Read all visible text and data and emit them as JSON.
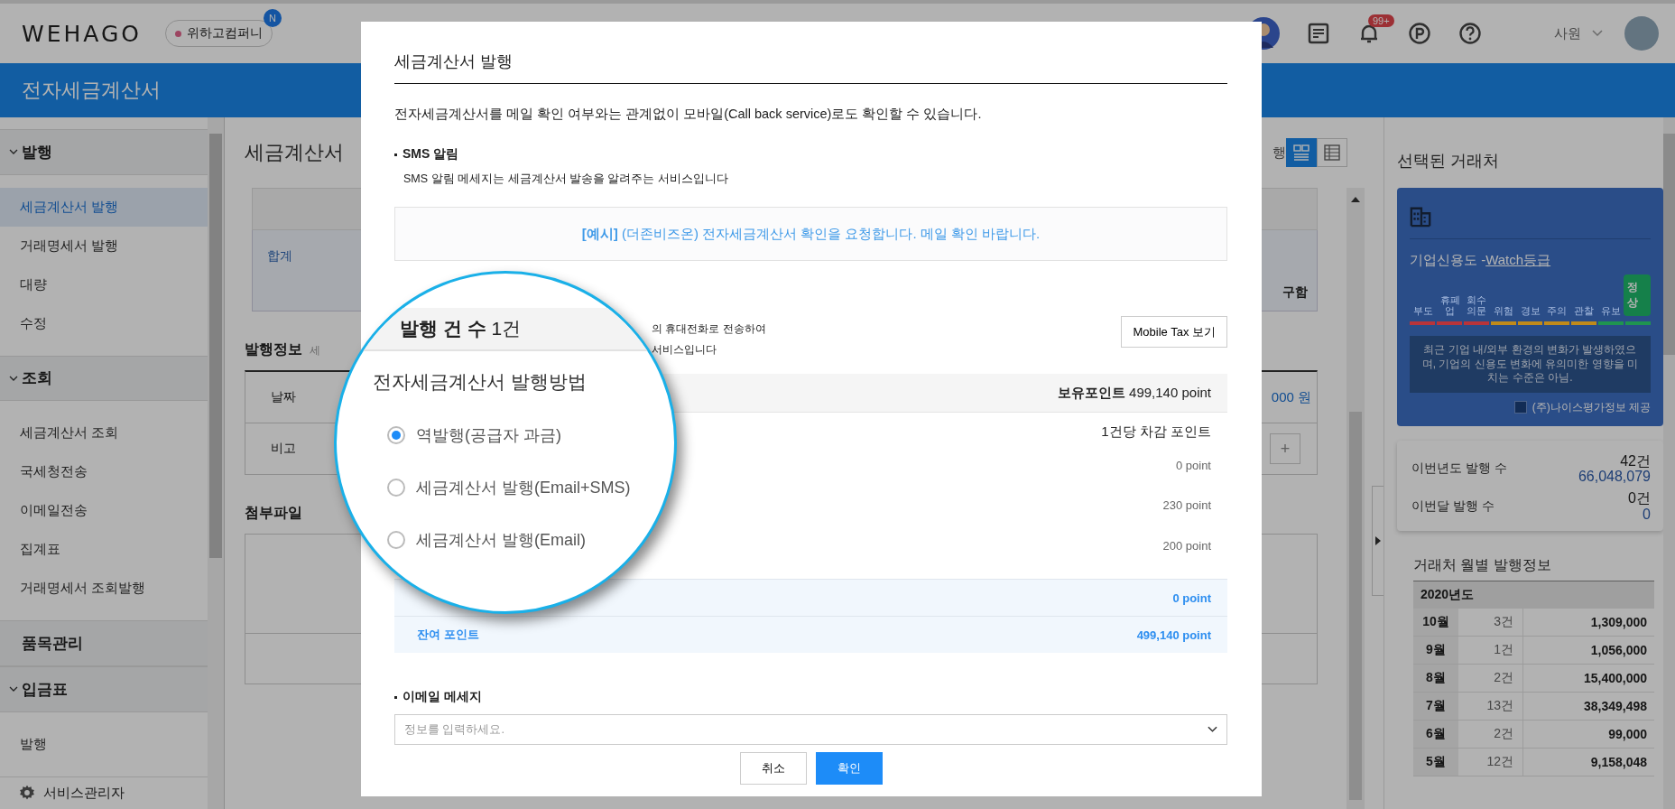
{
  "header": {
    "logo": "WEHAGO",
    "company": "위하고컴퍼니",
    "company_badge": "N",
    "notification_count": "99+",
    "user_role": "사원"
  },
  "app_bar": {
    "title": "전자세금계산서"
  },
  "sidebar": {
    "sections": [
      {
        "label": "발행",
        "items": [
          {
            "label": "세금계산서 발행",
            "selected": true
          },
          {
            "label": "거래명세서 발행",
            "selected": false
          },
          {
            "label": "대량",
            "selected": false
          },
          {
            "label": "수정",
            "selected": false
          }
        ]
      },
      {
        "label": "조회",
        "items": [
          {
            "label": "세금계산서 조회",
            "selected": false
          },
          {
            "label": "국세청전송",
            "selected": false
          },
          {
            "label": "이메일전송",
            "selected": false
          },
          {
            "label": "집계표",
            "selected": false
          },
          {
            "label": "거래명세서 조회발행",
            "selected": false
          }
        ]
      },
      {
        "label": "품목관리"
      },
      {
        "label": "입금표",
        "items": [
          {
            "label": "발행",
            "selected": false
          }
        ]
      }
    ],
    "footer": "서비스관리자"
  },
  "main": {
    "title": "세금계산서",
    "toolbar_text": "행",
    "view_buttons": [
      {
        "kind": "cards",
        "selected": true
      },
      {
        "kind": "grid",
        "selected": false
      }
    ],
    "summary_label": "합계",
    "summary_text": "구함",
    "issue_title": "발행정보",
    "issue_subtitle": "세",
    "issue_rows": [
      {
        "label": "날짜",
        "kind": "amount",
        "value": "000 원"
      },
      {
        "label": "비고",
        "kind": "add"
      }
    ],
    "add_symbol": "+",
    "attachment_title": "첨부파일"
  },
  "right_panel": {
    "title": "선택된 거래처",
    "credit": {
      "title": "기업신용도 - ",
      "grade_link": "Watch등급",
      "levels": [
        {
          "label": "부도",
          "color": "#b8343a",
          "selected": false
        },
        {
          "label": "휴폐업",
          "color": "#b8343a",
          "selected": false
        },
        {
          "label": "회수의문",
          "color": "#b8343a",
          "selected": false
        },
        {
          "label": "위험",
          "color": "#c08a1a",
          "selected": false
        },
        {
          "label": "경보",
          "color": "#c08a1a",
          "selected": false
        },
        {
          "label": "주의",
          "color": "#c08a1a",
          "selected": false
        },
        {
          "label": "관찰",
          "color": "#c08a1a",
          "selected": false
        },
        {
          "label": "유보",
          "color": "#1f9450",
          "selected": false
        },
        {
          "label": "정상",
          "color": "#1f9450",
          "selected": true
        }
      ],
      "description": "최근 기업 내/외부 환경의 변화가 발생하였으며, 기업의 신용도 변화에 유의미한 영향을 미치는 수준은 아님.",
      "provider": "(주)나이스평가정보 제공"
    },
    "stats": [
      {
        "label": "이번년도 발행 수",
        "count": "42건",
        "amount": "66,048,079"
      },
      {
        "label": "이번달 발행 수",
        "count": "0건",
        "amount": "0"
      }
    ],
    "monthly_title": "거래처 월별 발행정보",
    "year": "2020년도",
    "months": [
      {
        "month": "10월",
        "count": "3건",
        "amount": "1,309,000"
      },
      {
        "month": "9월",
        "count": "1건",
        "amount": "1,056,000"
      },
      {
        "month": "8월",
        "count": "2건",
        "amount": "15,400,000"
      },
      {
        "month": "7월",
        "count": "13건",
        "amount": "38,349,498"
      },
      {
        "month": "6월",
        "count": "2건",
        "amount": "99,000"
      },
      {
        "month": "5월",
        "count": "12건",
        "amount": "9,158,048"
      }
    ]
  },
  "modal": {
    "title": "세금계산서 발행",
    "description": "전자세금계산서를 메일 확인 여부와는 관계없이 모바일(Call back service)로도 확인할 수 있습니다.",
    "sms_title": "SMS 알림",
    "sms_text": "SMS 알림 메세지는 세금계산서 발송을 알려주는 서비스입니다",
    "example": "**[예시]** (더존비즈온) 전자세금계산서 확인을 요청합니다. 메일 확인 바랍니다.",
    "mobile_lines": [
      "의 휴대전화로 전송하여",
      "서비스입니다"
    ],
    "mobile_button": "Mobile Tax 보기",
    "holding_label": "보유포인트",
    "holding_value": "499,140 point",
    "deduct_header": "1건당 차감 포인트",
    "option_points": [
      "0 point",
      "230 point",
      "200 point"
    ],
    "total_value": "0 point",
    "remaining_label": "잔여 포인트",
    "remaining_value": "499,140 point",
    "email_title": "이메일 메세지",
    "email_placeholder": "정보를 입력하세요.",
    "buttons": [
      {
        "label": "취소",
        "kind": "secondary"
      },
      {
        "label": "확인",
        "kind": "primary"
      }
    ]
  },
  "magnifier": {
    "count_label": "발행 건 수",
    "count_value": "1건",
    "method_title": "전자세금계산서 발행방법",
    "options": [
      {
        "label": "역발행(공급자 과금)",
        "selected": true
      },
      {
        "label": "세금계산서 발행(Email+SMS)",
        "selected": false
      },
      {
        "label": "세금계산서 발행(Email)",
        "selected": false
      }
    ]
  }
}
